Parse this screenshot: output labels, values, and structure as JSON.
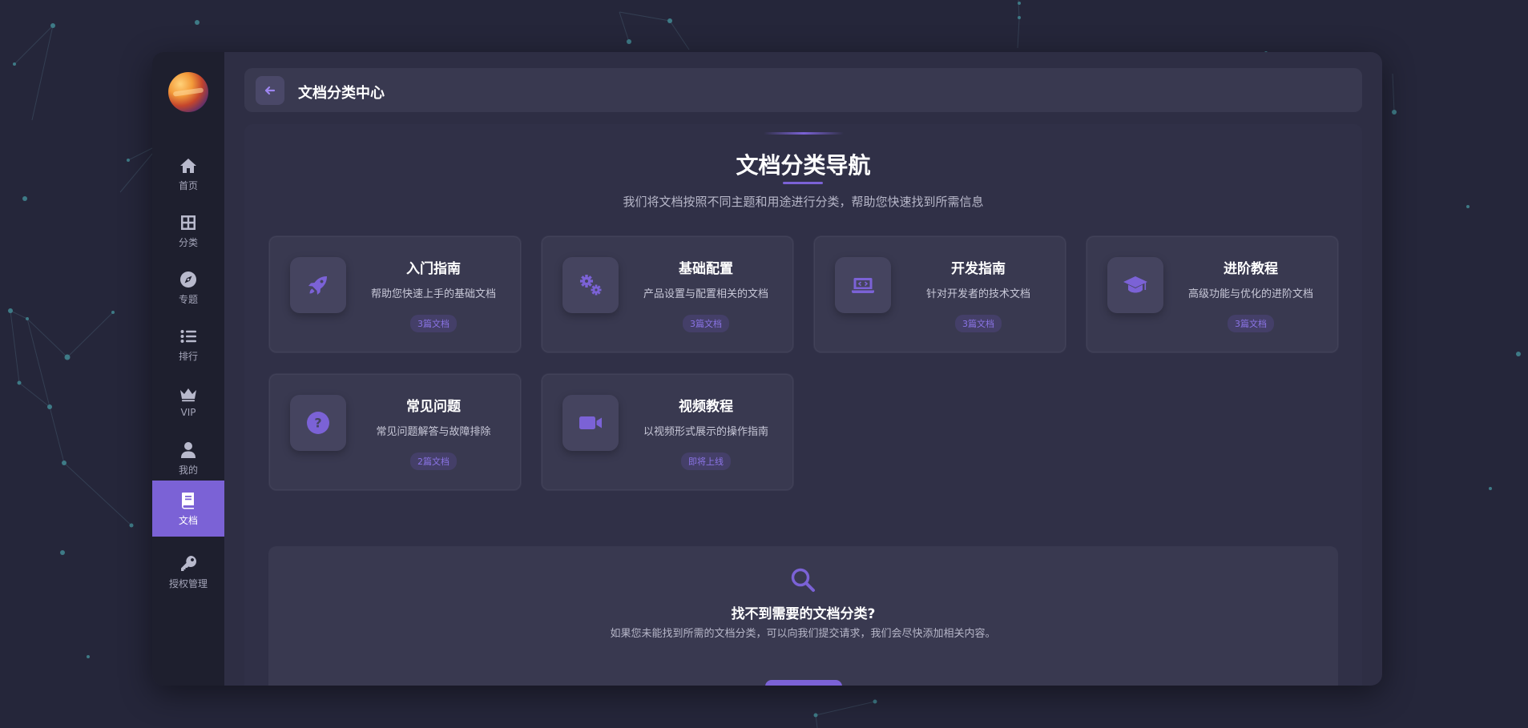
{
  "sidebar": {
    "items": [
      {
        "label": "首页",
        "icon": "home-icon"
      },
      {
        "label": "分类",
        "icon": "grid-icon"
      },
      {
        "label": "专题",
        "icon": "compass-icon"
      },
      {
        "label": "排行",
        "icon": "list-icon"
      },
      {
        "label": "VIP",
        "icon": "crown-icon"
      },
      {
        "label": "我的",
        "icon": "user-icon"
      },
      {
        "label": "文档",
        "icon": "book-icon",
        "active": true
      },
      {
        "label": "授权管理",
        "icon": "key-icon"
      }
    ]
  },
  "header": {
    "title": "文档分类中心"
  },
  "section": {
    "title": "文档分类导航",
    "subtitle": "我们将文档按照不同主题和用途进行分类，帮助您快速找到所需信息"
  },
  "categories": [
    {
      "title": "入门指南",
      "desc": "帮助您快速上手的基础文档",
      "badge": "3篇文档",
      "icon": "rocket-icon"
    },
    {
      "title": "基础配置",
      "desc": "产品设置与配置相关的文档",
      "badge": "3篇文档",
      "icon": "gears-icon"
    },
    {
      "title": "开发指南",
      "desc": "针对开发者的技术文档",
      "badge": "3篇文档",
      "icon": "laptop-code-icon"
    },
    {
      "title": "进阶教程",
      "desc": "高级功能与优化的进阶文档",
      "badge": "3篇文档",
      "icon": "graduation-cap-icon"
    },
    {
      "title": "常见问题",
      "desc": "常见问题解答与故障排除",
      "badge": "2篇文档",
      "icon": "question-circle-icon"
    },
    {
      "title": "视频教程",
      "desc": "以视频形式展示的操作指南",
      "badge": "即将上线",
      "icon": "video-icon"
    }
  ],
  "help": {
    "title": "找不到需要的文档分类?",
    "desc": "如果您未能找到所需的文档分类，可以向我们提交请求，我们会尽快添加相关内容。",
    "icon": "search-icon"
  },
  "colors": {
    "accent": "#7b62d6",
    "background": "#25263a",
    "sidebar": "#1e1f2e",
    "card": "#393950"
  }
}
